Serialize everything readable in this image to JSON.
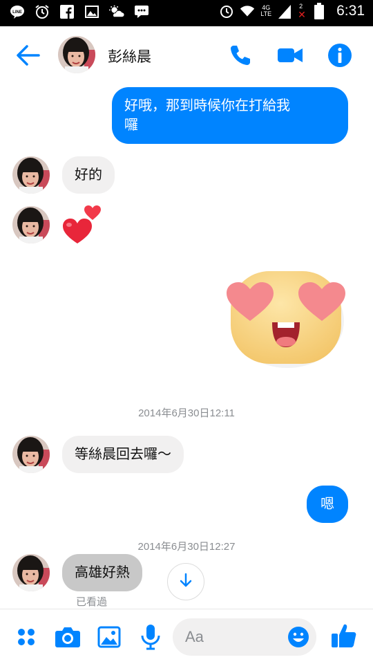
{
  "status_bar": {
    "time": "6:31",
    "network": "4G",
    "network_sub": "LTE",
    "notif_count": "2",
    "icons": [
      "line-icon",
      "alarm-icon",
      "facebook-icon",
      "image-icon",
      "weather-icon",
      "chat-icon"
    ]
  },
  "header": {
    "contact_name": "彭絲晨",
    "accent": "#0084ff"
  },
  "messages": {
    "m1": "好哦，那到時候你在打給我囉",
    "m1_line1": "好哦，那到時候你在打給我",
    "m1_line2": "囉",
    "m2": "好的",
    "ts1": "2014年6月30日12:11",
    "m5": "等絲晨回去囉～",
    "m6": "嗯",
    "ts2": "2014年6月30日12:27",
    "m7": "高雄好熱",
    "seen": "已看過"
  },
  "composer": {
    "placeholder": "Aa"
  },
  "colors": {
    "outgoing": "#0084ff",
    "incoming": "#f1f0f0",
    "timestamp": "#8a8d91"
  }
}
